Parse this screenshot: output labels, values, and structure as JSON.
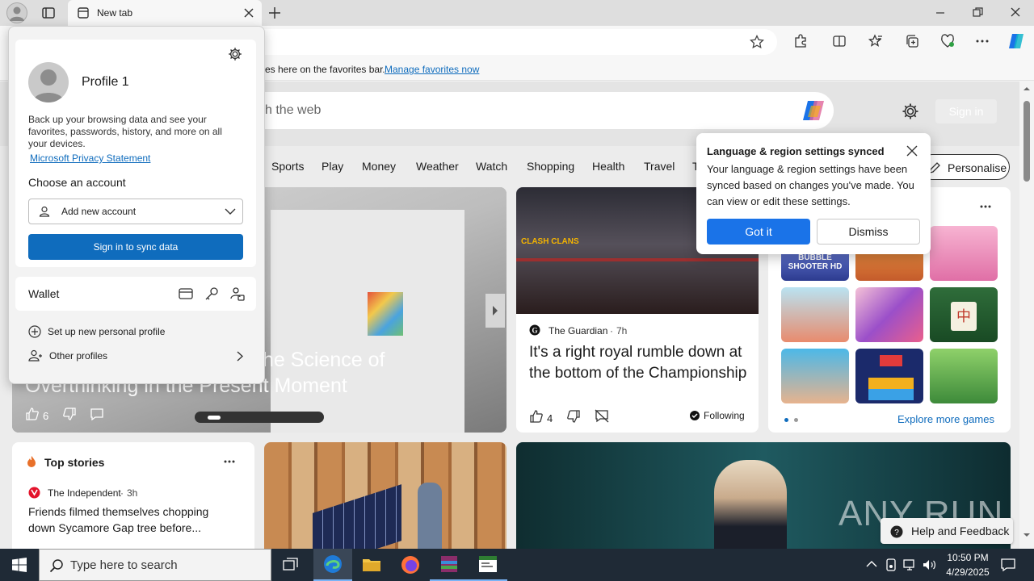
{
  "tab": {
    "title": "New tab"
  },
  "favorites_bar": {
    "text": "es here on the favorites bar.",
    "link": "Manage favorites now"
  },
  "search": {
    "placeholder": "h the web"
  },
  "header": {
    "signin": "Sign in"
  },
  "categories": [
    "Sports",
    "Play",
    "Money",
    "Weather",
    "Watch",
    "Shopping",
    "Health",
    "Travel",
    "T"
  ],
  "personalise": "Personalise",
  "profile_panel": {
    "name": "Profile 1",
    "description": "Back up your browsing data and see your favorites, passwords, history, and more on all your devices.",
    "privacy_link": "Microsoft Privacy Statement",
    "choose_account": "Choose an account",
    "add_account": "Add new account",
    "sync_button": "Sign in to sync data",
    "wallet": "Wallet",
    "setup_profile": "Set up new personal profile",
    "other_profiles": "Other profiles"
  },
  "sync_popup": {
    "title": "Language & region settings synced",
    "body": "Your language & region settings have been synced based on changes you've made. You can view or edit these settings.",
    "got_it": "Got it",
    "dismiss": "Dismiss"
  },
  "main_story": {
    "title_line1": "he Science of",
    "title_line2": "Overthinking in the Present Moment",
    "likes": "6"
  },
  "guardian_story": {
    "source": "The Guardian",
    "age": "7h",
    "title": "It's a right royal rumble down at the bottom of the Championship",
    "likes": "4",
    "following": "Following",
    "image_text": "CLASH CLANS"
  },
  "games": {
    "explore": "Explore more games",
    "bubble_label": "BUBBLE SHOOTER HD"
  },
  "top_stories": {
    "title": "Top stories",
    "source": "The Independent",
    "age": "3h",
    "headline": "Friends filmed themselves chopping down Sycamore Gap tree before..."
  },
  "watermark": "ANY RUN",
  "help": "Help and Feedback",
  "taskbar": {
    "search_placeholder": "Type here to search",
    "time": "10:50 PM",
    "date": "4/29/2025"
  },
  "colors": {
    "accent": "#0f6cbd",
    "got_it": "#1a73e8",
    "taskbar": "#1f2a36"
  }
}
